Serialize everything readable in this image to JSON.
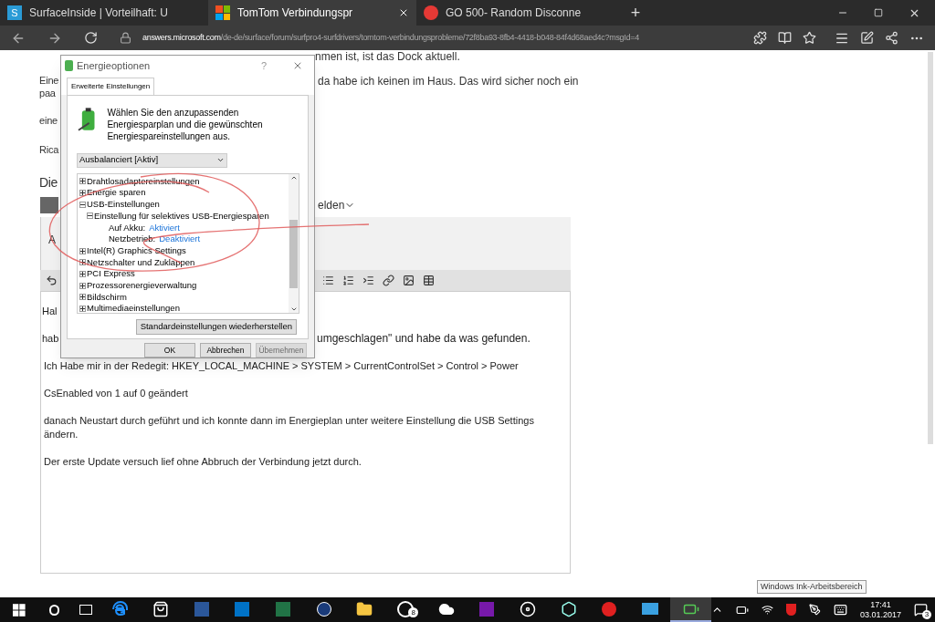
{
  "browser": {
    "tabs": [
      {
        "title": "SurfaceInside | Vorteilhaft: U",
        "selected": false,
        "icon_text": "S"
      },
      {
        "title": "TomTom Verbindungspr",
        "selected": true
      },
      {
        "title": "GO 500- Random Disconne",
        "selected": false
      }
    ],
    "new_tab": "+",
    "address": {
      "host": "answers.microsoft.com",
      "path": "/de-de/surface/forum/surfpro4-surfdrivers/tomtom-verbindungsprobleme/72f8ba93-8fb4-4418-b048-84f4d68aed4c?msgId=4"
    }
  },
  "page": {
    "top_line": "nmen ist, ist das Dock aktuell.",
    "left_fragments": [
      "Eine",
      "paa",
      "eine",
      "Rica"
    ],
    "right_line": "da habe ich keinen im Haus. Das wird sicher noch ein",
    "heading_fragment": "Die",
    "menu_fragment": "elden",
    "editor_fragment": "A",
    "editor_lines": [
      {
        "left": "Hal"
      },
      {
        "left": "hab",
        "right": "umgeschlagen\" und habe da was gefunden."
      }
    ],
    "paragraphs": [
      {
        "text": "Ich Habe mir in der Redegit: HKEY_LOCAL_MACHINE > SYSTEM > CurrentControlSet > Control > Power"
      },
      {
        "text": "CsEnabled von 1 auf 0 geändert"
      },
      {
        "text": "danach Neustart durch geführt und ich konnte dann im Energieplan unter weitere Einstellung die USB Settings ändern."
      },
      {
        "text": "Der erste Update versuch lief ohne Abbruch der Verbindung jetzt durch."
      }
    ]
  },
  "dialog": {
    "title": "Energieoptionen",
    "help": "?",
    "tab": {
      "label": "Erweiterte Einstellungen",
      "selected": true
    },
    "description": "Wählen Sie den anzupassenden Energiesparplan und die gewünschten Energiespareinstellungen aus.",
    "plan": "Ausbalanciert [Aktiv]",
    "tree": [
      {
        "label": "Drahtlosadaptereinstellungen",
        "expanded": false
      },
      {
        "label": "Energie sparen",
        "expanded": false
      },
      {
        "label": "USB-Einstellungen",
        "expanded": true,
        "children": [
          {
            "label": "Einstellung für selektives USB-Energiesparen",
            "expanded": true,
            "children": [
              {
                "label": "Auf Akku:",
                "value": "Aktiviert"
              },
              {
                "label": "Netzbetrieb:",
                "value": "Deaktiviert"
              }
            ]
          }
        ]
      },
      {
        "label": "Intel(R) Graphics Settings",
        "expanded": false
      },
      {
        "label": "Netzschalter und Zuklappen",
        "expanded": false
      },
      {
        "label": "PCI Express",
        "expanded": false
      },
      {
        "label": "Prozessorenergieverwaltung",
        "expanded": false
      },
      {
        "label": "Bildschirm",
        "expanded": false
      },
      {
        "label": "Multimediaeinstellungen",
        "expanded": false
      }
    ],
    "restore_button": "Standardeinstellungen wiederherstellen",
    "buttons": [
      {
        "label": "OK",
        "disabled": false
      },
      {
        "label": "Abbrechen",
        "disabled": false
      },
      {
        "label": "Übernehmen",
        "disabled": true
      }
    ]
  },
  "tooltip": "Windows Ink-Arbeitsbereich",
  "taskbar": {
    "apps": [
      {
        "kind": "edge",
        "active": false
      },
      {
        "kind": "store",
        "active": false
      },
      {
        "kind": "word",
        "active": false
      },
      {
        "kind": "outlook",
        "active": false
      },
      {
        "kind": "excel",
        "active": false
      },
      {
        "kind": "clock",
        "active": false
      },
      {
        "kind": "folder",
        "active": false
      },
      {
        "kind": "badge",
        "active": false,
        "badge": "8"
      },
      {
        "kind": "cloud",
        "active": false
      },
      {
        "kind": "onenote",
        "active": false
      },
      {
        "kind": "disc",
        "active": false
      },
      {
        "kind": "hex",
        "active": false
      },
      {
        "kind": "red",
        "active": false
      },
      {
        "kind": "card",
        "active": false
      },
      {
        "kind": "battery",
        "active": true
      }
    ],
    "time": "17:41",
    "date": "03.01.2017",
    "notifications": "3"
  }
}
